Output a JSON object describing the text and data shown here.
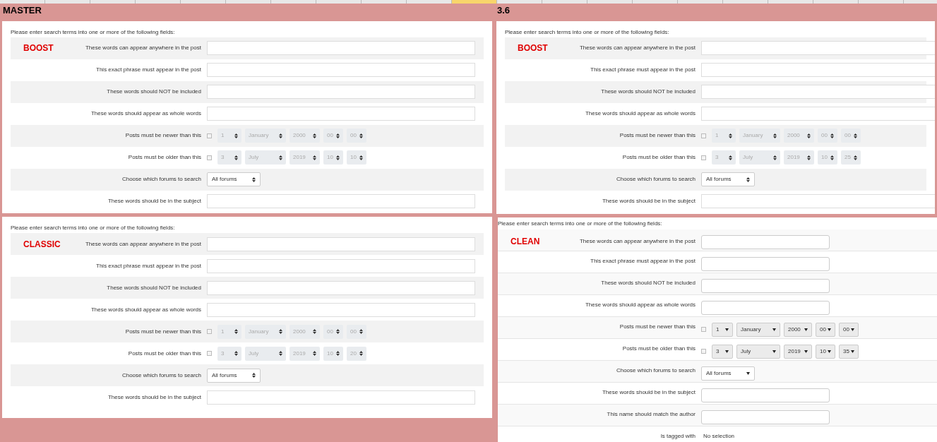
{
  "sections": [
    {
      "title": "MASTER",
      "panels": [
        {
          "kind": "boost",
          "theme_label": "BOOST",
          "intro": "Please enter search terms into one or more of the following fields:",
          "rows": [
            {
              "kind": "text",
              "label": "These words can appear anywhere in the post"
            },
            {
              "kind": "text",
              "label": "This exact phrase must appear in the post"
            },
            {
              "kind": "text",
              "label": "These words should NOT be included"
            },
            {
              "kind": "text",
              "label": "These words should appear as whole words"
            },
            {
              "kind": "date",
              "label": "Posts must be newer than this",
              "checked": false,
              "disabled": true,
              "parts": [
                "1",
                "January",
                "2000",
                "00",
                "00"
              ]
            },
            {
              "kind": "date",
              "label": "Posts must be older than this",
              "checked": false,
              "disabled": true,
              "parts": [
                "3",
                "July",
                "2019",
                "10",
                "10"
              ]
            },
            {
              "kind": "select",
              "label": "Choose which forums to search",
              "value": "All forums"
            },
            {
              "kind": "text",
              "label": "These words should be in the subject"
            }
          ]
        },
        {
          "kind": "boost",
          "theme_label": "CLASSIC",
          "intro": "Please enter search terms into one or more of the following fields:",
          "rows": [
            {
              "kind": "text",
              "label": "These words can appear anywhere in the post"
            },
            {
              "kind": "text",
              "label": "This exact phrase must appear in the post"
            },
            {
              "kind": "text",
              "label": "These words should NOT be included"
            },
            {
              "kind": "text",
              "label": "These words should appear as whole words"
            },
            {
              "kind": "date",
              "label": "Posts must be newer than this",
              "checked": false,
              "disabled": true,
              "parts": [
                "1",
                "January",
                "2000",
                "00",
                "00"
              ]
            },
            {
              "kind": "date",
              "label": "Posts must be older than this",
              "checked": false,
              "disabled": true,
              "parts": [
                "3",
                "July",
                "2019",
                "10",
                "20"
              ]
            },
            {
              "kind": "select",
              "label": "Choose which forums to search",
              "value": "All forums"
            },
            {
              "kind": "text",
              "label": "These words should be in the subject"
            }
          ]
        }
      ]
    },
    {
      "title": "3.6",
      "panels": [
        {
          "kind": "boost",
          "theme_label": "BOOST",
          "intro": "Please enter search terms into one or more of the following fields:",
          "rows": [
            {
              "kind": "text",
              "label": "These words can appear anywhere in the post"
            },
            {
              "kind": "text",
              "label": "This exact phrase must appear in the post"
            },
            {
              "kind": "text",
              "label": "These words should NOT be included"
            },
            {
              "kind": "text",
              "label": "These words should appear as whole words"
            },
            {
              "kind": "date",
              "label": "Posts must be newer than this",
              "checked": false,
              "disabled": true,
              "parts": [
                "1",
                "January",
                "2000",
                "00",
                "00"
              ]
            },
            {
              "kind": "date",
              "label": "Posts must be older than this",
              "checked": false,
              "disabled": true,
              "parts": [
                "3",
                "July",
                "2019",
                "10",
                "25"
              ]
            },
            {
              "kind": "select",
              "label": "Choose which forums to search",
              "value": "All forums"
            },
            {
              "kind": "text",
              "label": "These words should be in the subject"
            }
          ]
        },
        {
          "kind": "clean",
          "theme_label": "CLEAN",
          "intro": "Please enter search terms into one or more of the following fields:",
          "rows": [
            {
              "kind": "text",
              "label": "These words can appear anywhere in the post"
            },
            {
              "kind": "text",
              "label": "This exact phrase must appear in the post"
            },
            {
              "kind": "text",
              "label": "These words should NOT be included"
            },
            {
              "kind": "text",
              "label": "These words should appear as whole words"
            },
            {
              "kind": "date",
              "label": "Posts must be newer than this",
              "checked": false,
              "disabled": false,
              "parts": [
                "1",
                "January",
                "2000",
                "00",
                "00"
              ]
            },
            {
              "kind": "date",
              "label": "Posts must be older than this",
              "checked": false,
              "disabled": false,
              "parts": [
                "3",
                "July",
                "2019",
                "10",
                "35"
              ]
            },
            {
              "kind": "select",
              "label": "Choose which forums to search",
              "value": "All forums"
            },
            {
              "kind": "text",
              "label": "These words should be in the subject"
            },
            {
              "kind": "text",
              "label": "This name should match the author"
            },
            {
              "kind": "static",
              "label": "Is tagged with",
              "value": "No selection"
            }
          ]
        }
      ]
    }
  ]
}
